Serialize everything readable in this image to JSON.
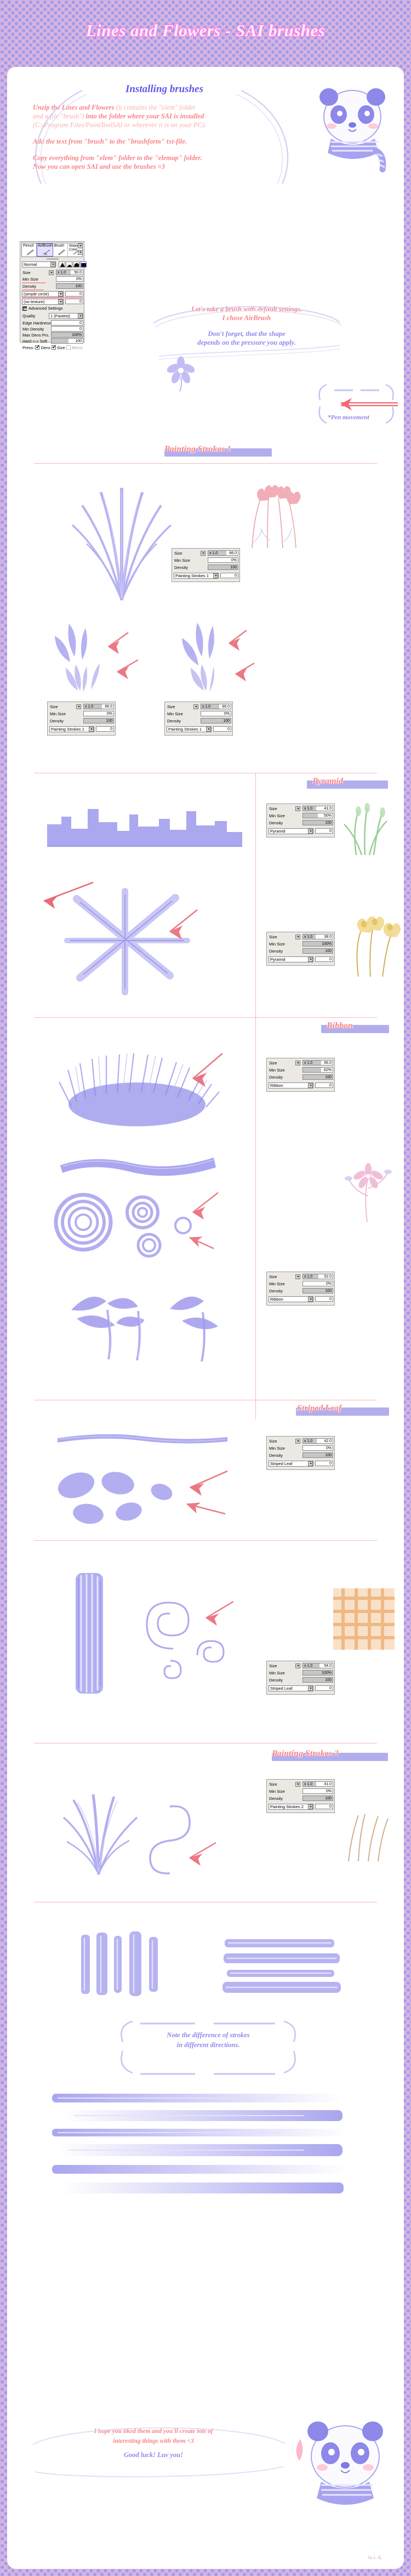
{
  "page": {
    "title": "Lines and Flowers - SAI brushes",
    "bg_color": "#dcb4dc",
    "dot_color": "#9f9ef0",
    "card_color": "#ffffff",
    "accent_red": "#fa8285",
    "accent_violet": "#8e89ee",
    "heading_violet": "#5f5ae8"
  },
  "install": {
    "heading": "Installing brushes",
    "steps": [
      {
        "bold": "Unzip the Lines and Flowers ",
        "light": "(it contains the \"elem\" folder"
      },
      {
        "light": "and a file \"brush\") ",
        "bold": "into the folder where your SAI is installed"
      },
      {
        "bold": "(C:/Program Files/PaintToolSAI or wherever it is on your PC)."
      },
      {
        "bold": "Add the text from \"brush\" to the \"brushform\" txt-file."
      },
      {
        "bold": "Copy everything from \"elem\" folder to the \"elemap\" folder."
      },
      {
        "bold": "Now you can open SAI and use the brushes =3"
      }
    ]
  },
  "notes": {
    "default_settings_1": "Let's take a brush with default settings.",
    "default_settings_2": "I chose AirBrush",
    "pressure_1": "Don't forget, that the shape",
    "pressure_2": "depends on the pressure you apply.",
    "pen_movement": "*Pen movement",
    "direction_1": "Note the difference of strokes",
    "direction_2": "in different directions.",
    "outro_1": "I hope you liked them and you'll create lots of",
    "outro_2": "interesting things with them <3",
    "outro_3": "Good luck! Luv you!"
  },
  "main_panel": {
    "presets": [
      "Pencil",
      "AirBrush",
      "Brush",
      "Water Color"
    ],
    "selected_preset": "AirBrush",
    "blend_mode": "Normal",
    "shape_selected_index": 3,
    "rows": [
      {
        "label": "Size",
        "prefix": "x 1.0",
        "value": "50.0",
        "fill": 55
      },
      {
        "label": "Min Size",
        "prefix": "",
        "value": "0%",
        "fill": 0
      },
      {
        "label": "Density",
        "prefix": "",
        "value": "100",
        "fill": 100
      }
    ],
    "shape_select": "(simple circle)",
    "shape_value": "0",
    "texture_select": "(no texture)",
    "texture_value": "0",
    "advanced_label": "Advanced Settings",
    "advanced": [
      {
        "label": "Quailty",
        "value": "1 (Fastest)",
        "type": "select"
      },
      {
        "label": "Edge Hardness",
        "value": "0",
        "fill": 0
      },
      {
        "label": "Min Density",
        "value": "0",
        "fill": 0
      },
      {
        "label": "Max Dens Prs.",
        "value": "100%",
        "fill": 100
      },
      {
        "label": "Hard <-> Soft",
        "value": "100",
        "fill": 55
      }
    ],
    "press_label": "Press:",
    "press_options": [
      {
        "label": "Dens",
        "checked": true,
        "enabled": true
      },
      {
        "label": "Size",
        "checked": true,
        "enabled": true
      },
      {
        "label": "Blend",
        "checked": false,
        "enabled": false
      }
    ]
  },
  "sections": [
    {
      "id": "painting-strokes-1",
      "title": "Painting Strokes 1"
    },
    {
      "id": "pyramid",
      "title": "Pyramid"
    },
    {
      "id": "ribbon",
      "title": "Ribbon"
    },
    {
      "id": "striped-leaf",
      "title": "Striped Leaf"
    },
    {
      "id": "painting-strokes-2",
      "title": "Painting Strokes 2"
    }
  ],
  "brush_panels": [
    {
      "id": "ps1-a",
      "rows": [
        {
          "label": "Size",
          "prefix": "x 1.0",
          "value": "66.0",
          "fill": 62
        },
        {
          "label": "Min Size",
          "prefix": "",
          "value": "0%",
          "fill": 0
        },
        {
          "label": "Density",
          "prefix": "",
          "value": "100",
          "fill": 100
        }
      ],
      "shape": "Painting Strokes 1",
      "shape_value": "0"
    },
    {
      "id": "ps1-b",
      "rows": [
        {
          "label": "Size",
          "prefix": "x 1.0",
          "value": "66.0",
          "fill": 62
        },
        {
          "label": "Min Size",
          "prefix": "",
          "value": "0%",
          "fill": 0
        },
        {
          "label": "Density",
          "prefix": "",
          "value": "100",
          "fill": 100
        }
      ],
      "shape": "Painting Strokes 1",
      "shape_value": "0"
    },
    {
      "id": "ps1-c",
      "rows": [
        {
          "label": "Size",
          "prefix": "x 1.0",
          "value": "66.0",
          "fill": 62
        },
        {
          "label": "Min Size",
          "prefix": "",
          "value": "0%",
          "fill": 0
        },
        {
          "label": "Density",
          "prefix": "",
          "value": "100",
          "fill": 100
        }
      ],
      "shape": "Painting Strokes 1",
      "shape_value": "0"
    },
    {
      "id": "pyr-a",
      "rows": [
        {
          "label": "Size",
          "prefix": "x 1.0",
          "value": "41.0",
          "fill": 45
        },
        {
          "label": "Min Size",
          "prefix": "",
          "value": "50%",
          "fill": 50
        },
        {
          "label": "Density",
          "prefix": "",
          "value": "100",
          "fill": 100
        }
      ],
      "shape": "Pyramid",
      "shape_value": "0"
    },
    {
      "id": "pyr-b",
      "rows": [
        {
          "label": "Size",
          "prefix": "x 1.0",
          "value": "38.0",
          "fill": 42
        },
        {
          "label": "Min Size",
          "prefix": "",
          "value": "100%",
          "fill": 100
        },
        {
          "label": "Density",
          "prefix": "",
          "value": "100",
          "fill": 100
        }
      ],
      "shape": "Pyramid",
      "shape_value": "0"
    },
    {
      "id": "rib-a",
      "rows": [
        {
          "label": "Size",
          "prefix": "x 1.0",
          "value": "66.0",
          "fill": 62
        },
        {
          "label": "Min Size",
          "prefix": "",
          "value": "62%",
          "fill": 62
        },
        {
          "label": "Density",
          "prefix": "",
          "value": "100",
          "fill": 100
        }
      ],
      "shape": "Ribbon",
      "shape_value": "0"
    },
    {
      "id": "rib-b",
      "rows": [
        {
          "label": "Size",
          "prefix": "x 1.0",
          "value": "52.0",
          "fill": 52
        },
        {
          "label": "Min Size",
          "prefix": "",
          "value": "0%",
          "fill": 0
        },
        {
          "label": "Density",
          "prefix": "",
          "value": "100",
          "fill": 100
        }
      ],
      "shape": "Ribbon",
      "shape_value": "0"
    },
    {
      "id": "leaf-a",
      "rows": [
        {
          "label": "Size",
          "prefix": "x 1.0",
          "value": "42.0",
          "fill": 46
        },
        {
          "label": "Min Size",
          "prefix": "",
          "value": "0%",
          "fill": 0
        },
        {
          "label": "Density",
          "prefix": "",
          "value": "100",
          "fill": 100
        }
      ],
      "shape": "Striped Leaf",
      "shape_value": "0"
    },
    {
      "id": "leaf-b",
      "rows": [
        {
          "label": "Size",
          "prefix": "x 1.0",
          "value": "54.0",
          "fill": 55
        },
        {
          "label": "Min Size",
          "prefix": "",
          "value": "100%",
          "fill": 100
        },
        {
          "label": "Density",
          "prefix": "",
          "value": "100",
          "fill": 100
        }
      ],
      "shape": "Striped Leaf",
      "shape_value": "0"
    },
    {
      "id": "ps2-a",
      "rows": [
        {
          "label": "Size",
          "prefix": "x 1.0",
          "value": "41.0",
          "fill": 45
        },
        {
          "label": "Min Size",
          "prefix": "",
          "value": "0%",
          "fill": 0
        },
        {
          "label": "Density",
          "prefix": "",
          "value": "100",
          "fill": 100
        }
      ],
      "shape": "Painting Strokes 2",
      "shape_value": "0"
    }
  ],
  "signature": "by L. K."
}
